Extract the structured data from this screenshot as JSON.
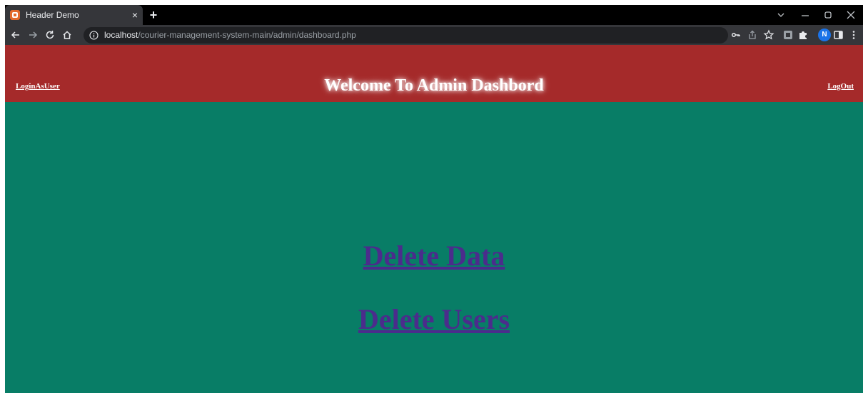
{
  "browser": {
    "tab_title": "Header Demo",
    "tab_close_glyph": "×",
    "new_tab_glyph": "+",
    "url_host": "localhost",
    "url_path": "/courier-management-system-main/admin/dashboard.php",
    "profile_initial": "N",
    "icons": [
      "back-icon",
      "forward-icon",
      "reload-icon",
      "home-icon",
      "info-icon",
      "key-icon",
      "share-icon",
      "star-icon",
      "extension-icon",
      "puzzle-icon",
      "side-panel-icon",
      "menu-icon",
      "minimize-icon",
      "restore-icon",
      "close-icon",
      "tab-search-icon"
    ]
  },
  "page": {
    "header": {
      "login_as_user": "LoginAsUser",
      "title": "Welcome To Admin Dashbord",
      "logout": "LogOut"
    },
    "links": {
      "delete_data": "Delete Data",
      "delete_users": "Delete Users"
    },
    "colors": {
      "header_bg": "#a52a2a",
      "page_bg": "#087d66",
      "link": "#4b2c8c"
    }
  }
}
